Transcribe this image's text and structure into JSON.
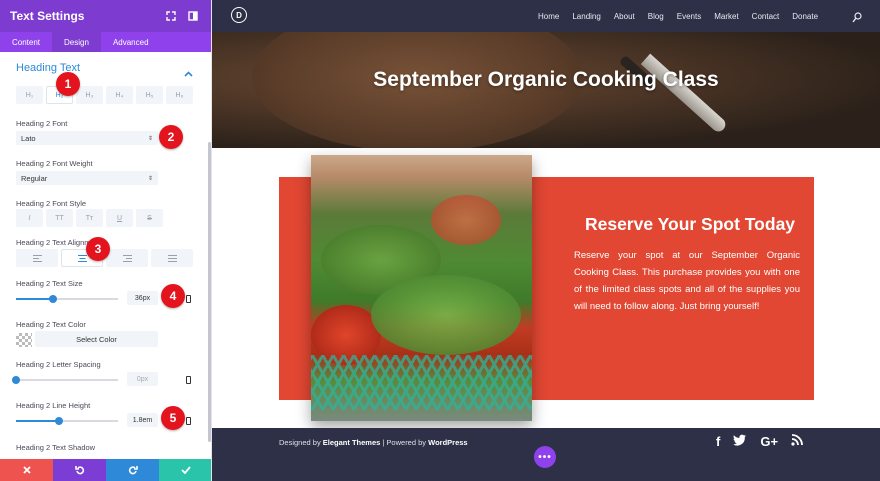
{
  "panel": {
    "title": "Text Settings",
    "tabs": [
      {
        "label": "Content",
        "active": false
      },
      {
        "label": "Design",
        "active": true
      },
      {
        "label": "Advanced",
        "active": false
      }
    ],
    "section_title": "Heading Text",
    "heading_levels": [
      "H₁",
      "H₂",
      "H₃",
      "H₄",
      "H₅",
      "H₆"
    ],
    "heading_font": {
      "label": "Heading 2 Font",
      "value": "Lato"
    },
    "font_weight": {
      "label": "Heading 2 Font Weight",
      "value": "Regular"
    },
    "font_style": {
      "label": "Heading 2 Font Style",
      "buttons": [
        "I",
        "TT",
        "Tт",
        "U",
        "S"
      ]
    },
    "text_align": {
      "label": "Heading 2 Text Alignment"
    },
    "text_size": {
      "label": "Heading 2 Text Size",
      "value": "36px",
      "level": 0.36
    },
    "text_color": {
      "label": "Heading 2 Text Color",
      "button": "Select Color"
    },
    "letter_spacing": {
      "label": "Heading 2 Letter Spacing",
      "placeholder": "0px",
      "level": 0.0
    },
    "line_height": {
      "label": "Heading 2 Line Height",
      "value": "1.8em",
      "level": 0.42
    },
    "text_shadow": {
      "label": "Heading 2 Text Shadow"
    },
    "badges": [
      "1",
      "2",
      "3",
      "4",
      "5"
    ],
    "colors": {
      "header": "#7e3bd0",
      "tabs": "#8f42ec",
      "accent": "#2e8ad8",
      "badge": "#e3141d"
    },
    "bottom_bar": [
      {
        "icon": "close-icon",
        "color": "#ef5350"
      },
      {
        "icon": "undo-icon",
        "color": "#7b3dd4"
      },
      {
        "icon": "redo-icon",
        "color": "#2e8ad8"
      },
      {
        "icon": "check-icon",
        "color": "#29c4a9"
      }
    ]
  },
  "site": {
    "logo": "D",
    "menu": [
      "Home",
      "Landing",
      "About",
      "Blog",
      "Events",
      "Market",
      "Contact",
      "Donate"
    ],
    "hero_title": "September Organic Cooking Class",
    "card_title": "Reserve Your Spot Today",
    "card_text": "Reserve your spot at our September Organic Cooking Class. This purchase provides you with one of the limited class spots and all of the supplies you will need to follow along. Just bring yourself!",
    "footer": {
      "prefix": "Designed by ",
      "brand1": "Elegant Themes",
      "middle": " | Powered by ",
      "brand2": "WordPress"
    },
    "social": [
      "f",
      "twitter",
      "G+",
      "rss"
    ],
    "colors": {
      "nav": "#2d3047",
      "card": "#e14732",
      "fab": "#8f42ec"
    }
  }
}
